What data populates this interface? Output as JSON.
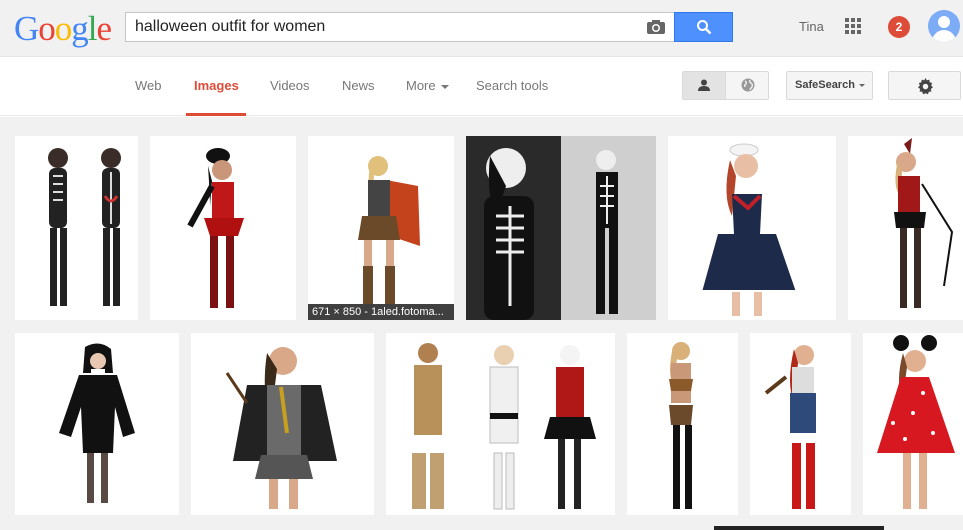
{
  "header": {
    "logo_letters": [
      "G",
      "o",
      "o",
      "g",
      "l",
      "e"
    ],
    "logo_colors": [
      "#4285f4",
      "#ea4335",
      "#fbbc05",
      "#4285f4",
      "#34a853",
      "#ea4335"
    ],
    "search_value": "halloween outfit for women",
    "user_name": "Tina",
    "notification_count": "2"
  },
  "nav": {
    "tabs": [
      {
        "label": "Web"
      },
      {
        "label": "Images"
      },
      {
        "label": "Videos"
      },
      {
        "label": "News"
      },
      {
        "label": "More"
      },
      {
        "label": "Search tools"
      }
    ],
    "active_tab": "Images",
    "safesearch_label": "SafeSearch"
  },
  "results": {
    "hover_caption": "671 × 850 - 1aled.fotoma..."
  },
  "colors": {
    "accent_red": "#dd4b39",
    "search_blue": "#4d90fe"
  }
}
